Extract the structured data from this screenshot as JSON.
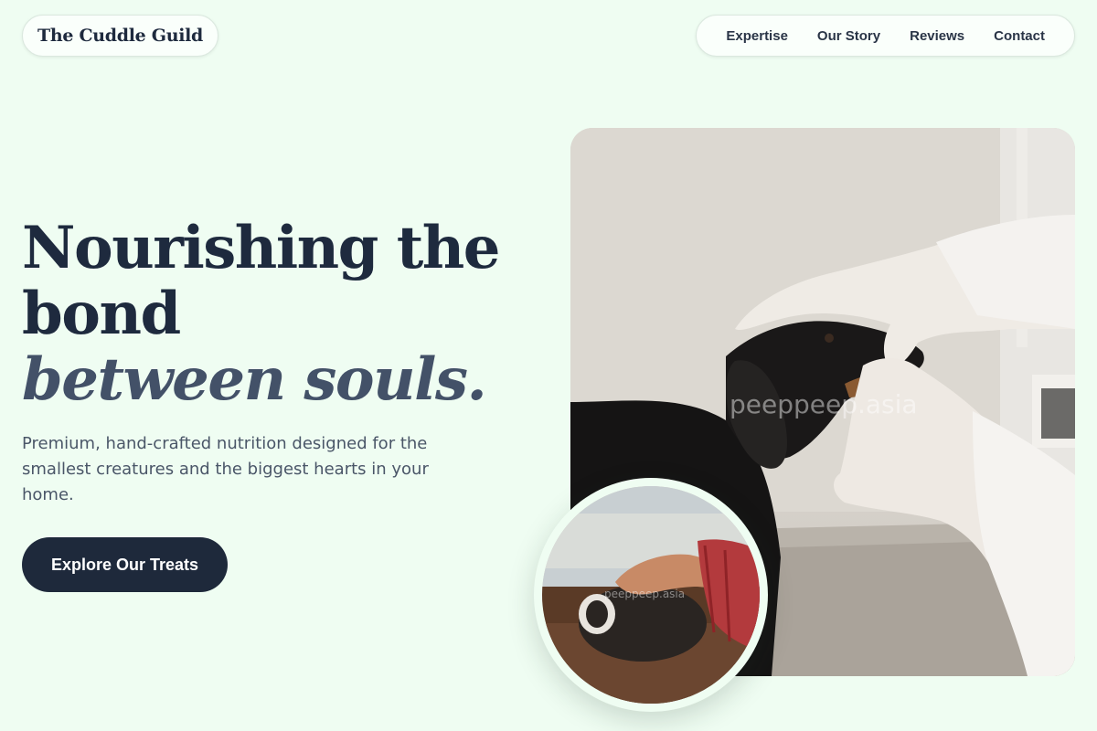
{
  "header": {
    "logo": "The Cuddle Guild",
    "nav": [
      {
        "label": "Expertise"
      },
      {
        "label": "Our Story"
      },
      {
        "label": "Reviews"
      },
      {
        "label": "Contact"
      }
    ]
  },
  "hero": {
    "title_line1": "Nourishing the",
    "title_line2": "bond",
    "title_line3": "between souls.",
    "subtitle": "Premium, hand-crafted nutrition designed for the smallest creatures and the biggest hearts in your home.",
    "cta_label": "Explore Our Treats"
  },
  "images": {
    "main_watermark": "peeppeep.asia",
    "inset_watermark": "peeppeep.asia"
  },
  "colors": {
    "background": "#effdf2",
    "primary": "#1e293b",
    "accent_text": "#435168"
  }
}
